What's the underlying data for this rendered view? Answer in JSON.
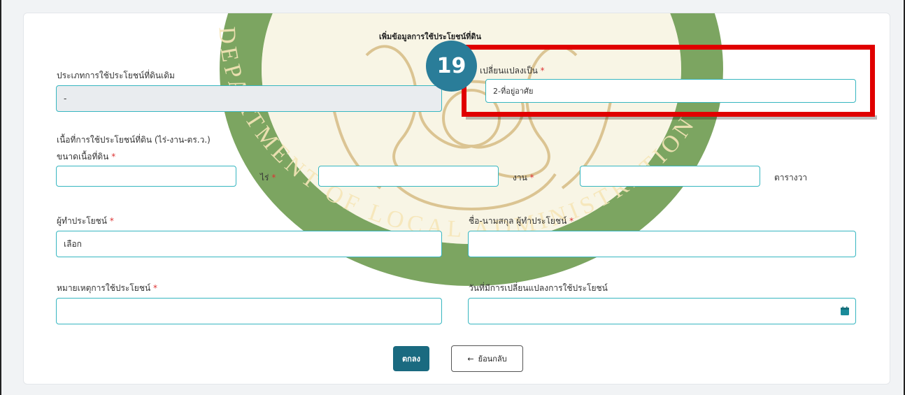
{
  "form": {
    "title": "เพิ่มข้อมูลการใช้ประโยชน์ที่ดิน",
    "original_use_label": "ประเภทการใช้ประโยชน์ที่ดินเดิม",
    "original_use_value": "-",
    "change_to_label": "เปลี่ยนแปลงเป็น",
    "change_to_value": "2-ที่อยู่อาศัย",
    "area_section_label": "เนื้อที่การใช้ประโยชน์ที่ดิน (ไร่-งาน-ตร.ว.)",
    "land_size_label": "ขนาดเนื้อที่ดิน",
    "rai_label": "ไร่",
    "ngan_label": "งาน",
    "wa_label": "ตารางวา",
    "beneficiary_label": "ผู้ทำประโยชน์",
    "beneficiary_value": "เลือก",
    "beneficiary_name_label": "ชื่อ-นามสกุล ผู้ทำประโยชน์",
    "remark_label": "หมายเหตุการใช้ประโยชน์",
    "change_date_label": "วันที่มีการเปลี่ยนแปลงการใช้ประโยชน์",
    "required_mark": "*"
  },
  "buttons": {
    "ok_label": "ตกลง",
    "back_label": "ย้อนกลับ",
    "back_arrow": "←"
  },
  "annotation": {
    "step_number": "19"
  },
  "watermark": {
    "text": "DEPARTMENT OF LOCAL ADMINISTRATION"
  },
  "icons": {
    "calendar": "calendar-icon"
  },
  "colors": {
    "accent": "#36b6c0",
    "primary_button": "#1a6a80",
    "highlight": "#e00000",
    "badge": "#2a7d99",
    "required": "#dd3333"
  }
}
